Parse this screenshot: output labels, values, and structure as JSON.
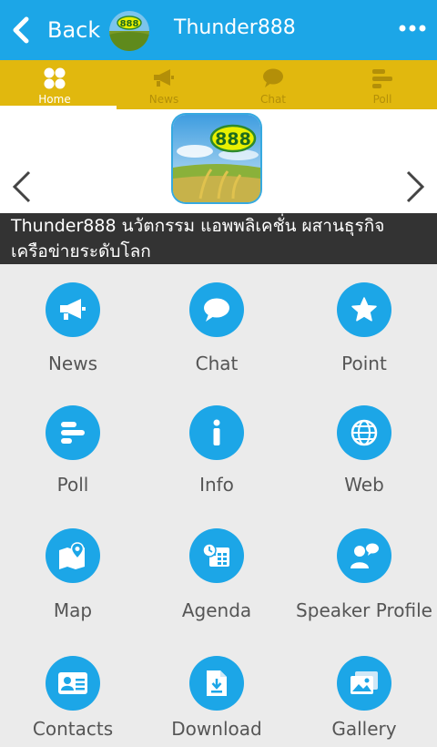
{
  "header": {
    "back_label": "Back",
    "title": "Thunder888",
    "logo_text": "888",
    "bg_color": "#1ca6e7"
  },
  "tabs": [
    {
      "label": "Home",
      "icon": "home-grid-icon",
      "active": true
    },
    {
      "label": "News",
      "icon": "megaphone-icon",
      "active": false
    },
    {
      "label": "Chat",
      "icon": "chat-bubble-icon",
      "active": false
    },
    {
      "label": "Poll",
      "icon": "poll-bars-icon",
      "active": false
    }
  ],
  "banner": {
    "logo_text": "888",
    "caption_line1": "Thunder888 นวัตกรรม แอพพลิเคชั่น ผสานธุรกิจ",
    "caption_line2": "เครือข่ายระดับโลก"
  },
  "menu": [
    {
      "label": "News",
      "icon": "megaphone-icon"
    },
    {
      "label": "Chat",
      "icon": "chat-bubble-icon"
    },
    {
      "label": "Point",
      "icon": "star-icon"
    },
    {
      "label": "Poll",
      "icon": "poll-bars-icon"
    },
    {
      "label": "Info",
      "icon": "info-icon"
    },
    {
      "label": "Web",
      "icon": "globe-icon"
    },
    {
      "label": "Map",
      "icon": "map-pin-icon"
    },
    {
      "label": "Agenda",
      "icon": "calendar-clock-icon"
    },
    {
      "label": "Speaker Profile",
      "icon": "speaker-people-icon"
    },
    {
      "label": "Contacts",
      "icon": "contact-card-icon"
    },
    {
      "label": "Download",
      "icon": "download-file-icon"
    },
    {
      "label": "Gallery",
      "icon": "gallery-photos-icon"
    }
  ],
  "colors": {
    "accent": "#1ca6e7",
    "tabbar": "#e1b80e",
    "caption_bg": "#333333",
    "grid_bg": "#ebebeb"
  }
}
